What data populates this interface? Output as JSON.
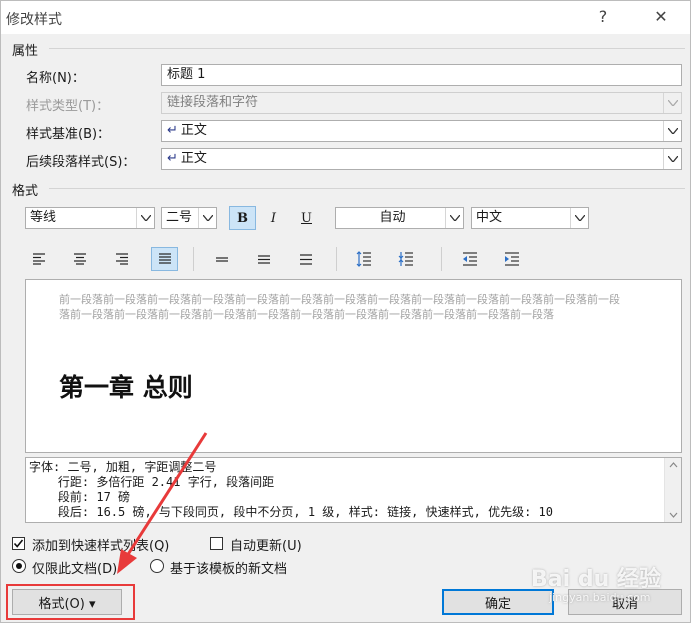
{
  "window": {
    "title": "修改样式",
    "help": "?",
    "close": "✕"
  },
  "properties": {
    "heading": "属性",
    "name_label": "名称(N)：",
    "name_value": "标题 1",
    "type_label": "样式类型(T)：",
    "type_value": "链接段落和字符",
    "base_label": "样式基准(B)：",
    "base_value": "正文",
    "next_label": "后续段落样式(S)：",
    "next_value": "正文"
  },
  "format": {
    "heading": "格式",
    "font": "等线",
    "size": "二号",
    "bold": "B",
    "italic": "I",
    "underline": "U",
    "color": "自动",
    "script": "中文"
  },
  "preview": {
    "prev_text": "前一段落前一段落前一段落前一段落前一段落前一段落前一段落前一段落前一段落前一段落前一段落前一段落前一段落前一段落前一段落前一段落前一段落前一段落前一段落前一段落前一段落前一段落前一段落前一段落",
    "heading": "第一章 总则"
  },
  "description": {
    "line1": "字体: 二号, 加粗, 字距调整二号",
    "line2": "    行距: 多倍行距 2.41 字行, 段落间距",
    "line3": "    段前: 17 磅",
    "line4": "    段后: 16.5 磅, 与下段同页, 段中不分页, 1 级, 样式: 链接, 快速样式, 优先级: 10"
  },
  "options": {
    "add_quick": "添加到快速样式列表(Q)",
    "auto_update": "自动更新(U)",
    "only_doc": "仅限此文档(D)",
    "new_template": "基于该模板的新文档"
  },
  "buttons": {
    "format": "格式(O) ▾",
    "ok": "确定",
    "cancel": "取消"
  },
  "watermark": {
    "logo": "Bai du 经验",
    "url": "jingyan.baidu.com"
  },
  "colors": {
    "highlight": "#e83a3a",
    "accent": "#0078d7"
  }
}
